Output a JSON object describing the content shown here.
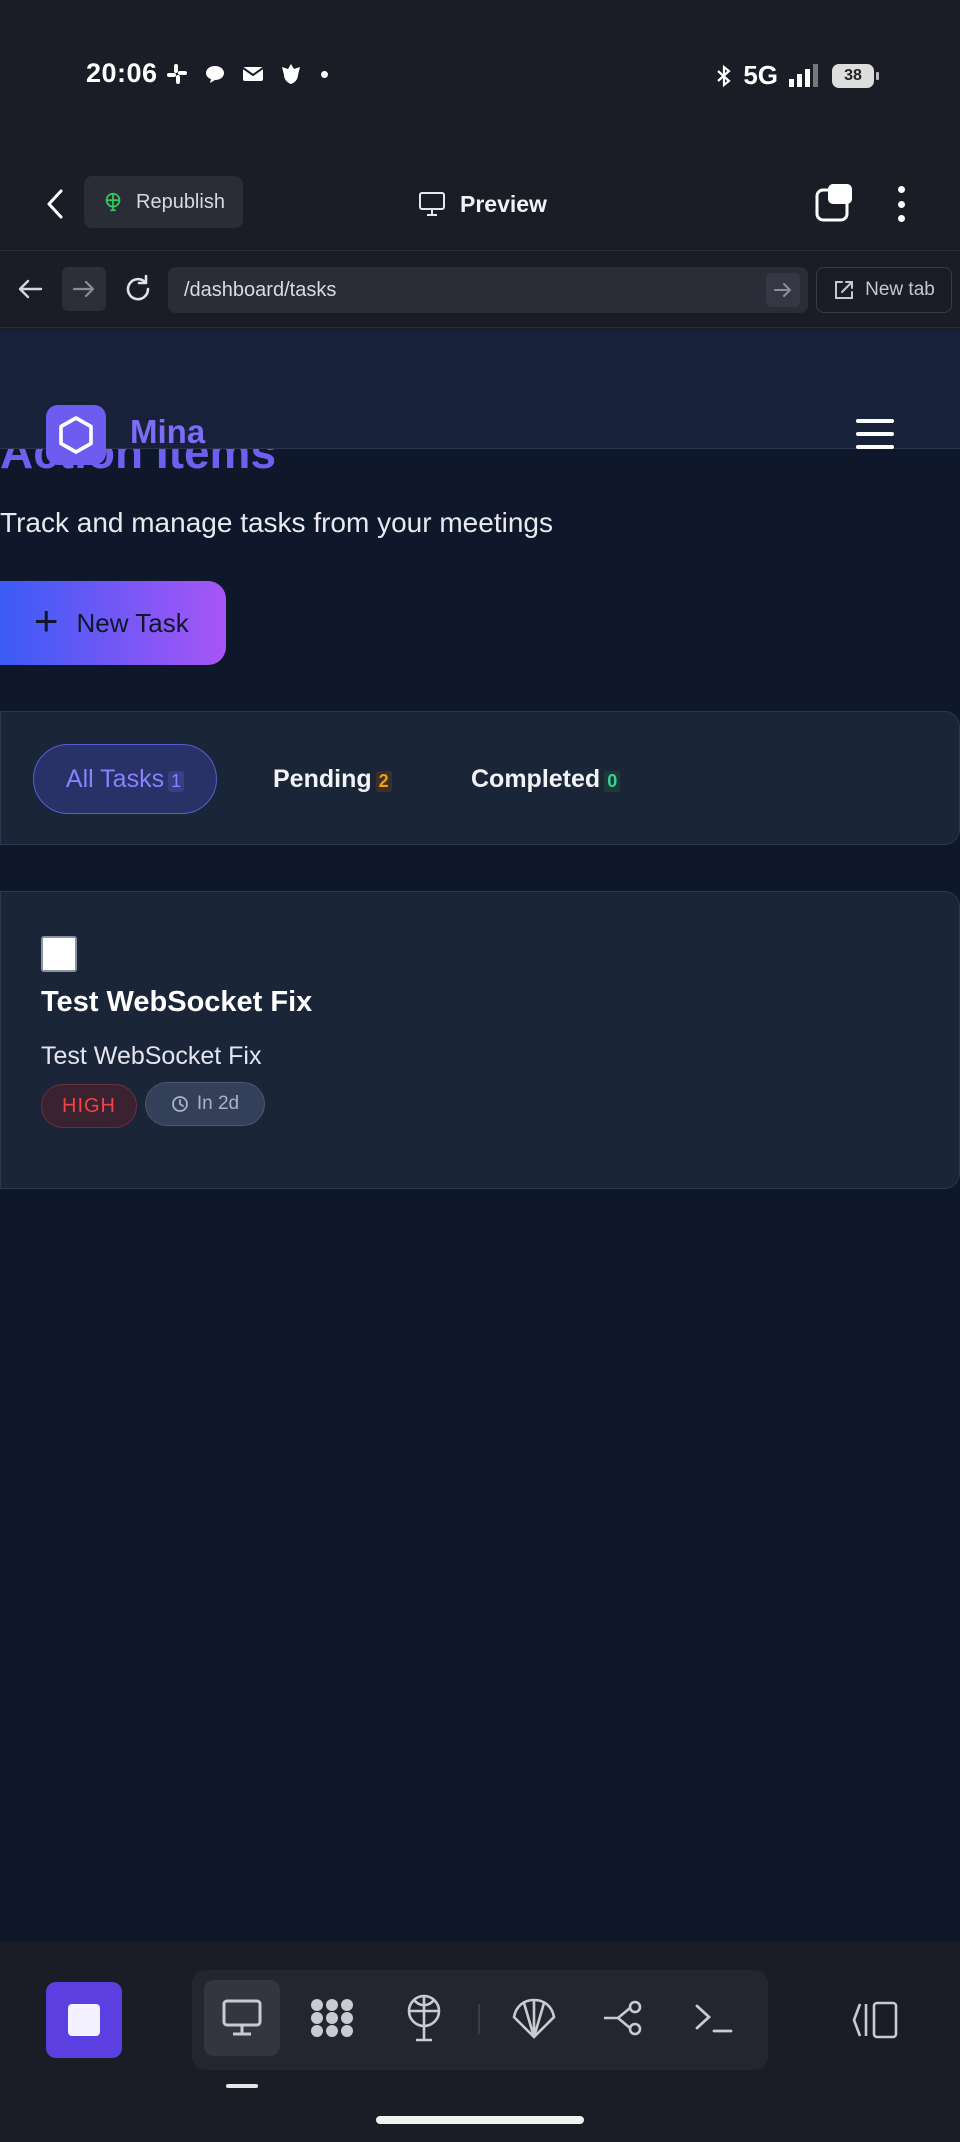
{
  "status_bar": {
    "time": "20:06",
    "network": "5G",
    "battery": "38",
    "notification_icons": [
      "slack-icon",
      "chat-bubble-icon",
      "mail-icon",
      "bank-icon",
      "more-dot-icon"
    ],
    "system_icons": [
      "bluetooth-icon",
      "signal-icon",
      "battery-icon"
    ]
  },
  "top_bar": {
    "republish_label": "Republish",
    "preview_label": "Preview"
  },
  "browser": {
    "url": "/dashboard/tasks",
    "new_tab_label": "New tab"
  },
  "app": {
    "brand": "Mina",
    "page_title": "Action Items",
    "page_subtitle": "Track and manage tasks from your meetings",
    "new_task_label": "New Task",
    "filters": [
      {
        "label": "All Tasks",
        "count": "1"
      },
      {
        "label": "Pending",
        "count": "2"
      },
      {
        "label": "Completed",
        "count": "0"
      }
    ],
    "tasks": [
      {
        "title": "Test WebSocket Fix",
        "description": "Test WebSocket Fix",
        "priority": "HIGH",
        "due": "In 2d"
      }
    ]
  },
  "colors": {
    "accent": "#6e5ff0",
    "gradient_start": "#3b5bf5",
    "gradient_end": "#a855f7",
    "priority_high": "#ef4444",
    "pending_count": "#f59e0b",
    "completed_count": "#34d399"
  },
  "bottom_toolbar": {
    "tools": [
      "desktop-icon",
      "apps-grid-icon",
      "deploy-icon",
      "shell-icon",
      "branch-icon",
      "terminal-icon"
    ]
  }
}
